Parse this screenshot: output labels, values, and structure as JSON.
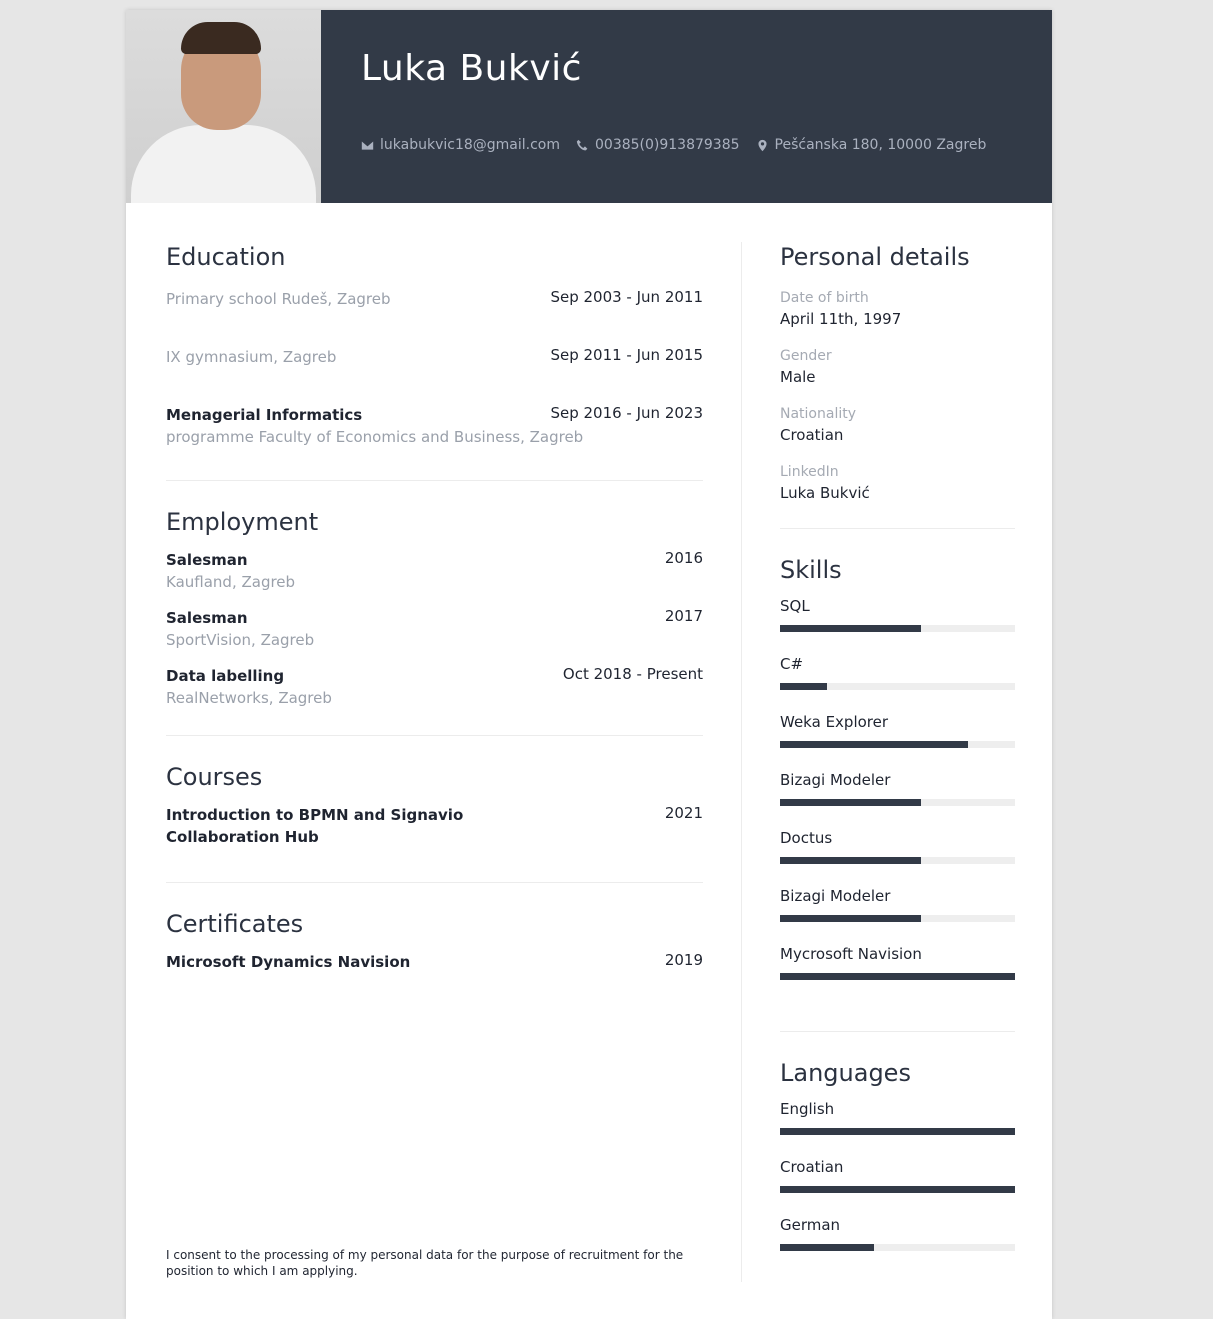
{
  "header": {
    "name": "Luka Bukvić",
    "email": "lukabukvic18@gmail.com",
    "phone": "00385(0)913879385",
    "address": "Pešćanska 180, 10000 Zagreb",
    "icons": [
      "envelope-icon",
      "phone-icon",
      "map-pin-icon"
    ]
  },
  "education": {
    "title": "Education",
    "items": [
      {
        "title": "",
        "sub": "Primary school Rudeš, Zagreb",
        "date": "Sep 2003 - Jun 2011"
      },
      {
        "title": "",
        "sub": "IX gymnasium, Zagreb",
        "date": "Sep 2011 - Jun 2015"
      },
      {
        "title": "Menagerial Informatics",
        "sub": "programme Faculty of Economics and Business, Zagreb",
        "date": "Sep 2016 - Jun 2023"
      }
    ]
  },
  "employment": {
    "title": "Employment",
    "items": [
      {
        "title": "Salesman",
        "sub": "Kaufland, Zagreb",
        "date": "2016"
      },
      {
        "title": "Salesman",
        "sub": "SportVision, Zagreb",
        "date": "2017"
      },
      {
        "title": "Data labelling",
        "sub": "RealNetworks, Zagreb",
        "date": "Oct 2018 - Present"
      }
    ]
  },
  "courses": {
    "title": "Courses",
    "items": [
      {
        "title": "Introduction to BPMN and Signavio Collaboration Hub",
        "date": "2021"
      }
    ]
  },
  "certificates": {
    "title": "Certificates",
    "items": [
      {
        "title": "Microsoft Dynamics Navision",
        "date": "2019"
      }
    ]
  },
  "personal": {
    "title": "Personal details",
    "items": [
      {
        "label": "Date of birth",
        "value": "April 11th, 1997"
      },
      {
        "label": "Gender",
        "value": "Male"
      },
      {
        "label": "Nationality",
        "value": "Croatian"
      },
      {
        "label": "LinkedIn",
        "value": "Luka Bukvić"
      }
    ]
  },
  "skills": {
    "title": "Skills",
    "items": [
      {
        "name": "SQL",
        "level": 0.6
      },
      {
        "name": "C#",
        "level": 0.2
      },
      {
        "name": "Weka Explorer",
        "level": 0.8
      },
      {
        "name": "Bizagi Modeler",
        "level": 0.6
      },
      {
        "name": "Doctus",
        "level": 0.6
      },
      {
        "name": "Bizagi Modeler",
        "level": 0.6
      },
      {
        "name": "Mycrosoft Navision",
        "level": 1.0
      }
    ]
  },
  "languages": {
    "title": "Languages",
    "items": [
      {
        "name": "English",
        "level": 1.0
      },
      {
        "name": "Croatian",
        "level": 1.0
      },
      {
        "name": "German",
        "level": 0.4
      }
    ]
  },
  "footer": {
    "consent": "I consent to the processing of my personal data for the purpose of recruitment for the position to which I am applying."
  }
}
